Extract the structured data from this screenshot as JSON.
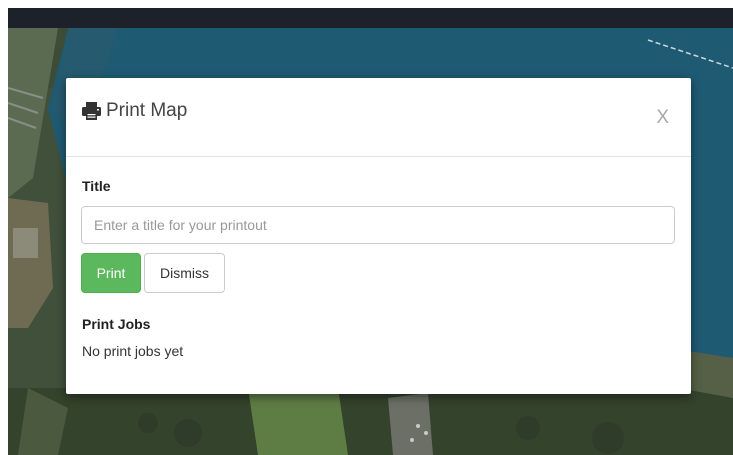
{
  "modal": {
    "title": "Print Map",
    "close_label": "X",
    "title_field_label": "Title",
    "title_input": {
      "value": "",
      "placeholder": "Enter a title for your printout"
    },
    "print_button": "Print",
    "dismiss_button": "Dismiss",
    "print_jobs_label": "Print Jobs",
    "print_jobs_empty": "No print jobs yet"
  },
  "icons": {
    "modal_title_icon": "printer-icon",
    "close_icon": "close-icon"
  },
  "colors": {
    "print_button": "#5cb85c",
    "topbar": "#1d2129",
    "water": "#1f5a73"
  }
}
